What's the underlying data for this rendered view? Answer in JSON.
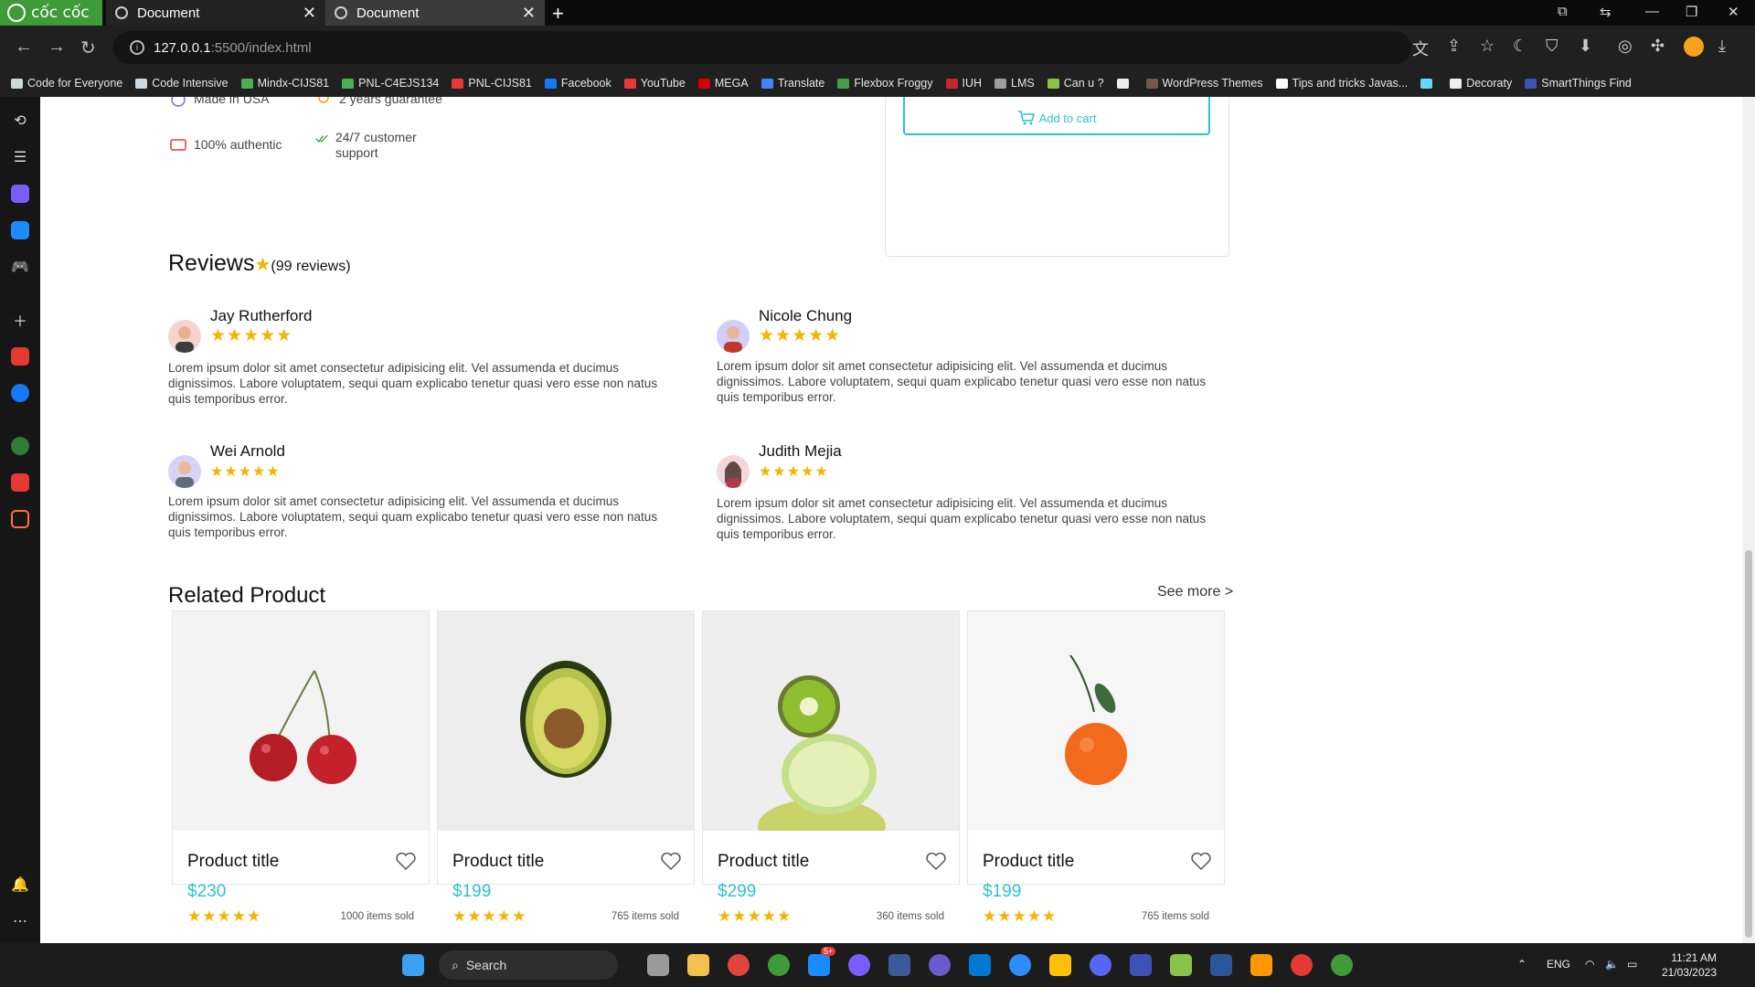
{
  "browser": {
    "brand": "cốc cốc",
    "tabs": [
      {
        "title": "Document",
        "active": true
      },
      {
        "title": "Document",
        "active": false
      }
    ],
    "url_host": "127.0.0.1",
    "url_rest": ":5500/index.html",
    "bookmarks": [
      {
        "label": "Code for Everyone",
        "color": "#cfd8dc"
      },
      {
        "label": "Code Intensive",
        "color": "#cfd8dc"
      },
      {
        "label": "Mindx-CIJS81",
        "color": "#4caf50"
      },
      {
        "label": "PNL-C4EJS134",
        "color": "#4caf50"
      },
      {
        "label": "PNL-CIJS81",
        "color": "#e53935"
      },
      {
        "label": "Facebook",
        "color": "#1877f2"
      },
      {
        "label": "YouTube",
        "color": "#e53935"
      },
      {
        "label": "MEGA",
        "color": "#d50000"
      },
      {
        "label": "Translate",
        "color": "#4285f4"
      },
      {
        "label": "Flexbox Froggy",
        "color": "#43a047"
      },
      {
        "label": "IUH",
        "color": "#c62828"
      },
      {
        "label": "LMS",
        "color": "#9e9e9e"
      },
      {
        "label": "Can u ?",
        "color": "#8bc34a"
      },
      {
        "label": "",
        "color": "#eeeeee"
      },
      {
        "label": "WordPress Themes",
        "color": "#795548"
      },
      {
        "label": "Tips and tricks Javas...",
        "color": "#ffffff"
      },
      {
        "label": "",
        "color": "#61dafb"
      },
      {
        "label": "Decoraty",
        "color": "#eeeeee"
      },
      {
        "label": "SmartThings Find",
        "color": "#3f51b5"
      }
    ]
  },
  "product_features": [
    {
      "label": "Made in USA",
      "icon": "globe-icon"
    },
    {
      "label": "2 years guarantee",
      "icon": "medal-icon"
    },
    {
      "label": "100% authentic",
      "icon": "message-icon"
    },
    {
      "label": "24/7 customer support",
      "icon": "check-icon"
    }
  ],
  "buy_box": {
    "add_to_cart": "Add to cart"
  },
  "reviews": {
    "title": "Reviews",
    "count_label": "(99 reviews)",
    "items": [
      {
        "name": "Jay Rutherford",
        "rating": 5,
        "text": "Lorem ipsum dolor sit amet consectetur adipisicing elit. Vel assumenda et ducimus dignissimos. Labore voluptatem, sequi quam explicabo tenetur quasi vero esse non natus quis temporibus error."
      },
      {
        "name": "Nicole Chung",
        "rating": 5,
        "text": "Lorem ipsum dolor sit amet consectetur adipisicing elit. Vel assumenda et ducimus dignissimos. Labore voluptatem, sequi quam explicabo tenetur quasi vero esse non natus quis temporibus error."
      },
      {
        "name": "Wei Arnold",
        "rating": 5,
        "text": "Lorem ipsum dolor sit amet consectetur adipisicing elit. Vel assumenda et ducimus dignissimos. Labore voluptatem, sequi quam explicabo tenetur quasi vero esse non natus quis temporibus error."
      },
      {
        "name": "Judith Mejia",
        "rating": 5,
        "text": "Lorem ipsum dolor sit amet consectetur adipisicing elit. Vel assumenda et ducimus dignissimos. Labore voluptatem, sequi quam explicabo tenetur quasi vero esse non natus quis temporibus error."
      }
    ]
  },
  "related": {
    "title": "Related Product",
    "see_more": "See more >",
    "products": [
      {
        "title": "Product title",
        "price": "$230",
        "sold": "1000 items sold",
        "rating": 5,
        "image": "cherry"
      },
      {
        "title": "Product title",
        "price": "$199",
        "sold": "765 items sold",
        "rating": 5,
        "image": "avocado"
      },
      {
        "title": "Product title",
        "price": "$299",
        "sold": "360 items sold",
        "rating": 5,
        "image": "kiwi-lime"
      },
      {
        "title": "Product title",
        "price": "$199",
        "sold": "765 items sold",
        "rating": 5,
        "image": "mandarin"
      }
    ]
  },
  "taskbar": {
    "search": "Search",
    "lang": "ENG",
    "time": "11:21 AM",
    "date": "21/03/2023",
    "zalo_badge": "5+"
  },
  "colors": {
    "accent": "#2cc3cc",
    "star": "#f4b400"
  }
}
